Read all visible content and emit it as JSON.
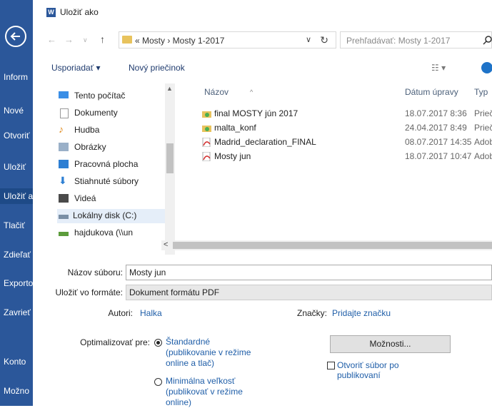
{
  "backstage": {
    "items": [
      {
        "label": "Inform",
        "selected": false
      },
      {
        "label": "Nové",
        "selected": false
      },
      {
        "label": "Otvoriť",
        "selected": false
      },
      {
        "label": "Uložiť",
        "selected": false
      },
      {
        "label": "Uložiť a",
        "selected": true
      },
      {
        "label": "Tlačiť",
        "selected": false
      },
      {
        "label": "Zdieľať",
        "selected": false
      },
      {
        "label": "Exporto",
        "selected": false
      },
      {
        "label": "Zavrieť",
        "selected": false
      },
      {
        "label": "Konto",
        "selected": false
      },
      {
        "label": "Možno",
        "selected": false
      }
    ]
  },
  "dialog": {
    "title": "Uložiť ako",
    "word_icon": "W",
    "address": {
      "text": "«  Mosty  ›  Mosty 1-2017",
      "chevron": "∨",
      "refresh": "↻"
    },
    "search": {
      "placeholder": "Prehľadávať: Mosty 1-2017",
      "icon": "search-icon"
    },
    "toolbar": {
      "organize_label": "Usporiadať ▾",
      "new_folder_label": "Nový priečinok",
      "view_label": "☷ ▾"
    },
    "nav_pane": [
      {
        "label": "Tento počítač",
        "icon": "computer-icon",
        "color": "#3a8ee6"
      },
      {
        "label": "Dokumenty",
        "icon": "documents-icon",
        "color": "#d9d9d9"
      },
      {
        "label": "Hudba",
        "icon": "music-icon",
        "color": "#e08a1e"
      },
      {
        "label": "Obrázky",
        "icon": "pictures-icon",
        "color": "#9ab0c8"
      },
      {
        "label": "Pracovná plocha",
        "icon": "desktop-icon",
        "color": "#2d7fd3"
      },
      {
        "label": "Stiahnuté súbory",
        "icon": "downloads-icon",
        "color": "#2d7fd3"
      },
      {
        "label": "Videá",
        "icon": "videos-icon",
        "color": "#4a4a4a"
      },
      {
        "label": "Lokálny disk (C:)",
        "icon": "drive-icon",
        "color": "#7a8fa6",
        "selected": true
      },
      {
        "label": "hajdukova (\\\\un",
        "icon": "network-drive-icon",
        "color": "#5c9c3c"
      }
    ],
    "columns": {
      "name": "Názov",
      "date": "Dátum úpravy",
      "type": "Typ"
    },
    "files": [
      {
        "name": "final MOSTY jún 2017",
        "date": "18.07.2017 8:36",
        "type": "Priečinok",
        "icon": "folder-icon"
      },
      {
        "name": "malta_konf",
        "date": "24.04.2017 8:49",
        "type": "Priečinok",
        "icon": "folder-icon"
      },
      {
        "name": "Madrid_declaration_FINAL",
        "date": "08.07.2017 14:35",
        "type": "Adobe",
        "icon": "pdf-icon"
      },
      {
        "name": "Mosty jun",
        "date": "18.07.2017 10:47",
        "type": "Adobe",
        "icon": "pdf-icon"
      }
    ],
    "form": {
      "filename_label": "Názov súboru:",
      "filename_value": "Mosty jun",
      "format_label": "Uložiť vo formáte:",
      "format_value": "Dokument formátu PDF",
      "authors_label": "Autori:",
      "authors_value": "Halka",
      "tags_label": "Značky:",
      "tags_value": "Pridajte značku",
      "optimize_label": "Optimalizovať pre:",
      "opt_standard": "Štandardné",
      "opt_standard_sub": "(publikovanie v režime online a tlač)",
      "opt_minimal": "Minimálna veľkosť",
      "opt_minimal_sub": "(publikovať v režime online)",
      "options_button": "Možnosti...",
      "open_after_label": "Otvoriť súbor po publikovaní"
    }
  }
}
